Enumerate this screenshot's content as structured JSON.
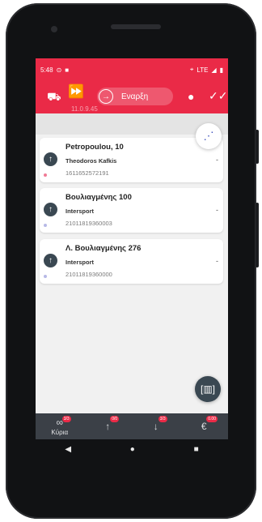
{
  "status_bar": {
    "time": "5:48",
    "network": "LTE"
  },
  "toolbar": {
    "version": "11.0.9.45",
    "start_label": "Εναρξη"
  },
  "stops": [
    {
      "address": "Petropoulou, 10",
      "name": "Theodoros Kafkis",
      "phone": "1611652572191",
      "value": "-",
      "dot_color": "#f07b96"
    },
    {
      "address": "Βουλιαγμένης 100",
      "name": "Intersport",
      "phone": "21011819360003",
      "value": "-",
      "dot_color": "#b7b9e6"
    },
    {
      "address": "Λ. Βουλιαγμένης 276",
      "name": "Intersport",
      "phone": "21011819360000",
      "value": "-",
      "dot_color": "#b7b9e6"
    }
  ],
  "bottom_nav": {
    "home": {
      "label": "Κύρια",
      "badge": "3/3",
      "icon": "infinity-icon"
    },
    "pickup": {
      "badge": "0/0",
      "icon": "arrow-up-icon"
    },
    "delivery": {
      "badge": "3/3",
      "icon": "arrow-down-icon"
    },
    "cash": {
      "badge": "0.00",
      "icon": "euro-icon"
    }
  },
  "colors": {
    "accent": "#ea2a47",
    "dark": "#3a4852",
    "nav": "#3b4047"
  }
}
